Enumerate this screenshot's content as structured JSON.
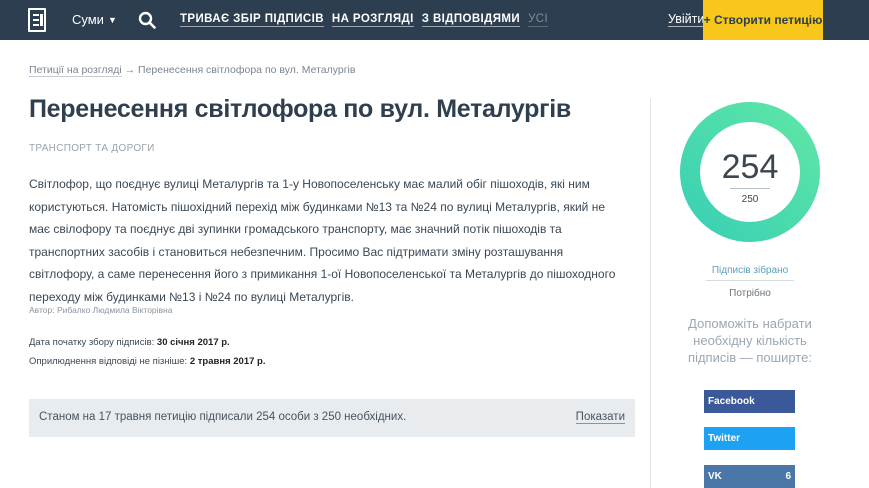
{
  "nav": {
    "city": "Суми",
    "links": [
      "ТРИВАЄ ЗБІР ПІДПИСІВ",
      "НА РОЗГЛЯДІ",
      "З ВІДПОВІДЯМИ"
    ],
    "link_all": "УСІ",
    "login": "Увійти",
    "create": "+ Створити петицію"
  },
  "breadcrumb": {
    "parent": "Петиції на розгляді",
    "sep": " → ",
    "current": "Перенесення світлофора по вул. Металургів"
  },
  "petition": {
    "title": "Перенесення світлофора по вул. Металургів",
    "category": "ТРАНСПОРТ ТА ДОРОГИ",
    "text": "Світлофор, що поєднує вулиці Металургів та 1-у Новопоселенську має малий обіг пішоходів, які ним користуються. Натомість пішохідний перехід між будинками №13 та №24 по вулиці Металургів, який не має свілофору та поєднує дві зупинки громадського транспорту, має значний потік пішоходів та транспортних засобів і становиться небезпечним. Просимо Вас підтримати зміну розташування світлофору, а саме перенесення його з примикання 1-ої Новопоселенської та Металургів до пішоходного переходу між будинками №13 і №24 по вулиці Металургів.",
    "author": "Автор: Рибалко Людмила Вікторівна",
    "start_label": "Дата початку збору підписів:",
    "start_date": "30 січня 2017 р.",
    "answer_label": "Оприлюднення відповіді не пізніше:",
    "answer_date": "2 травня 2017 р.",
    "status_text": "Станом на 17 травня петицію підписали 254 особи з 250 необхідних.",
    "show": "Показати"
  },
  "counter": {
    "collected": "254",
    "needed": "250",
    "progress": 1.0,
    "collected_label": "Підписів зібрано",
    "needed_label": "Потрібно",
    "help": "Допоможіть набрати необхідну кількість підписів — поширте:",
    "ring_colors": [
      "#3ad0b4",
      "#5ee6a6"
    ]
  },
  "share": {
    "facebook": "Facebook",
    "twitter": "Twitter",
    "vk": "VK",
    "vk_count": "6"
  }
}
